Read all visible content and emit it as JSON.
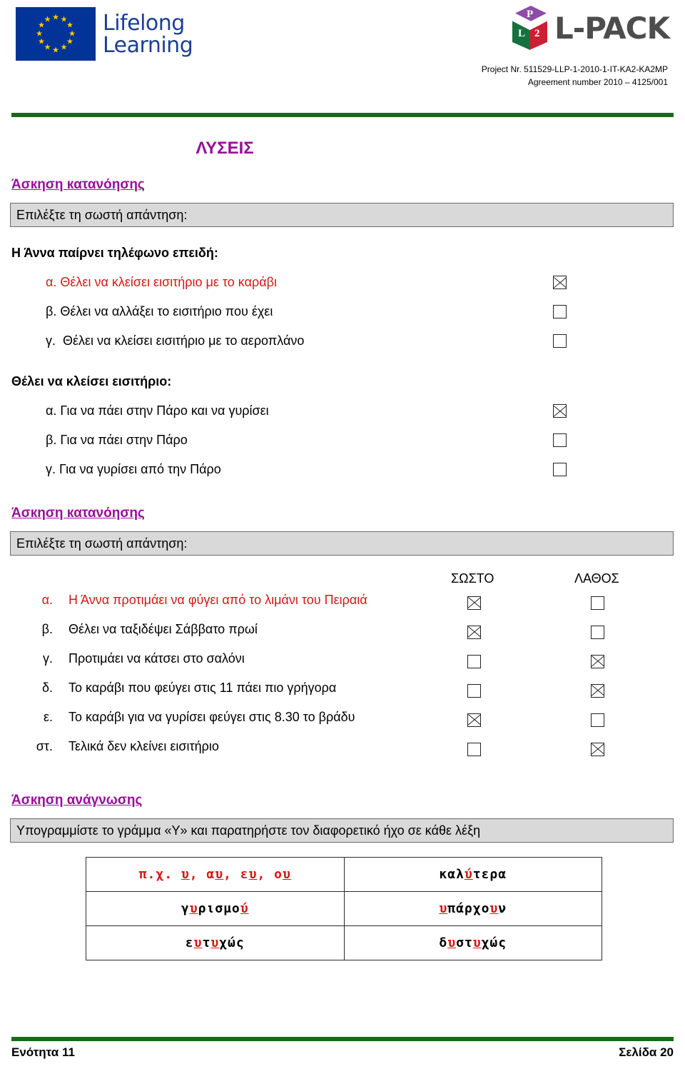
{
  "header": {
    "eu_logo_line1": "Lifelong",
    "eu_logo_line2": "Learning",
    "lpack_cube_top_letter": "P",
    "lpack_cube_left_letter": "L",
    "lpack_cube_right_letter": "2",
    "lpack_wordmark": "L-PACK",
    "project_number": "Project Nr. 511529-LLP-1-2010-1-IT-KA2-KA2MP",
    "agreement_number": "Agreement number 2010 – 4125/001"
  },
  "colors": {
    "heading_purple": "#980f98",
    "answer_red": "#d81616",
    "rule_green": "#176b17",
    "instruction_gray": "#d9d9d9",
    "eu_blue": "#023399"
  },
  "document": {
    "title": "ΛΥΣΕΙΣ"
  },
  "sections": [
    {
      "heading": "Άσкηση кατανόησης",
      "instruction": "Επιλέξτε τη σωστή απάντηση:",
      "questions": [
        {
          "prompt": "Η Άννα παίρνει τηλέφωνο επειδή:",
          "options": [
            {
              "label": "α. Θέλει να κλείσει εισιτήριο με το καράβι",
              "checked": true,
              "correct": true
            },
            {
              "label": "β. Θέλει να αλλάξει το εισιτήριο που έχει",
              "checked": false,
              "correct": false
            },
            {
              "label": "γ.  Θέλει να κλείσει εισιτήριο με το αεροπλάνο",
              "checked": false,
              "correct": false
            }
          ]
        },
        {
          "prompt": "Θέλει να κλείσει εισιτήριο:",
          "options": [
            {
              "label": "α. Για να πάει στην Πάρο και να γυρίσει",
              "checked": true,
              "correct": false
            },
            {
              "label": "β. Για να πάει στην Πάρο",
              "checked": false,
              "correct": false
            },
            {
              "label": "γ. Για να γυρίσει από την Πάρο",
              "checked": false,
              "correct": false
            }
          ]
        }
      ]
    },
    {
      "heading": "Άσкηση кατανόησης",
      "instruction": "Επιλέξτε τη σωστή απάντηση:",
      "true_false": {
        "col_true": "ΣΩΣΤΟ",
        "col_false": "ΛΑΘΟΣ",
        "rows": [
          {
            "key": "α.",
            "text": "Η Άννα προτιμάει να φύγει από το λιμάνι του Πειραιά",
            "true_checked": true,
            "false_checked": false,
            "highlight": true
          },
          {
            "key": "β.",
            "text": "Θέλει να ταξιδέψει Σάββατο πρωί",
            "true_checked": true,
            "false_checked": false,
            "highlight": false
          },
          {
            "key": "γ.",
            "text": "Προτιμάει να κάτσει στο σαλόνι",
            "true_checked": false,
            "false_checked": true,
            "highlight": false
          },
          {
            "key": "δ.",
            "text": "Το καράβι που φεύγει στις 11 πάει πιο γρήγορα",
            "true_checked": false,
            "false_checked": true,
            "highlight": false
          },
          {
            "key": "ε.",
            "text": "Το καράβι για να γυρίσει φεύγει στις 8.30 το βράδυ",
            "true_checked": true,
            "false_checked": false,
            "highlight": false
          },
          {
            "key": "στ.",
            "text": "Τελικά δεν κλείνει εισιτήριο",
            "true_checked": false,
            "false_checked": true,
            "highlight": false
          }
        ]
      }
    },
    {
      "heading": "Άσкηση ανάγνωσης",
      "instruction": "Υπογραμμίστε το γράμμα «Υ» και παρατηρήστε τον διαφορετικό ήχο σε κάθε λέξη",
      "word_table": {
        "rows": [
          {
            "left": {
              "plain": "π.χ. υ, αυ, ευ, ου",
              "all_red": true,
              "parts": [
                {
                  "t": "π.χ. ",
                  "u": false
                },
                {
                  "t": "υ",
                  "u": true
                },
                {
                  "t": ", α",
                  "u": false
                },
                {
                  "t": "υ",
                  "u": true
                },
                {
                  "t": ", ε",
                  "u": false
                },
                {
                  "t": "υ",
                  "u": true
                },
                {
                  "t": ", ο",
                  "u": false
                },
                {
                  "t": "υ",
                  "u": true
                }
              ]
            },
            "right": {
              "plain": "καλύτερα",
              "all_red": false,
              "parts": [
                {
                  "t": "καλ",
                  "u": false
                },
                {
                  "t": "ύ",
                  "u": true
                },
                {
                  "t": "τερα",
                  "u": false
                }
              ]
            }
          },
          {
            "left": {
              "plain": "γυρισμού",
              "all_red": false,
              "parts": [
                {
                  "t": "γ",
                  "u": false
                },
                {
                  "t": "υ",
                  "u": true
                },
                {
                  "t": "ρισμο",
                  "u": false
                },
                {
                  "t": "ύ",
                  "u": true
                }
              ]
            },
            "right": {
              "plain": "υπάρχουν",
              "all_red": false,
              "parts": [
                {
                  "t": "υ",
                  "u": true
                },
                {
                  "t": "πάρχο",
                  "u": false
                },
                {
                  "t": "υ",
                  "u": true
                },
                {
                  "t": "ν",
                  "u": false
                }
              ]
            }
          },
          {
            "left": {
              "plain": "ευτυχώς",
              "all_red": false,
              "parts": [
                {
                  "t": "ε",
                  "u": false
                },
                {
                  "t": "υ",
                  "u": true
                },
                {
                  "t": "τ",
                  "u": false
                },
                {
                  "t": "υ",
                  "u": true
                },
                {
                  "t": "χώς",
                  "u": false
                }
              ]
            },
            "right": {
              "plain": "δυστυχώς",
              "all_red": false,
              "parts": [
                {
                  "t": "δ",
                  "u": false
                },
                {
                  "t": "υ",
                  "u": true
                },
                {
                  "t": "στ",
                  "u": false
                },
                {
                  "t": "υ",
                  "u": true
                },
                {
                  "t": "χώς",
                  "u": false
                }
              ]
            }
          }
        ]
      }
    }
  ],
  "footer": {
    "unit": "Ενότητα 11",
    "page": "Σελίδα 20"
  }
}
